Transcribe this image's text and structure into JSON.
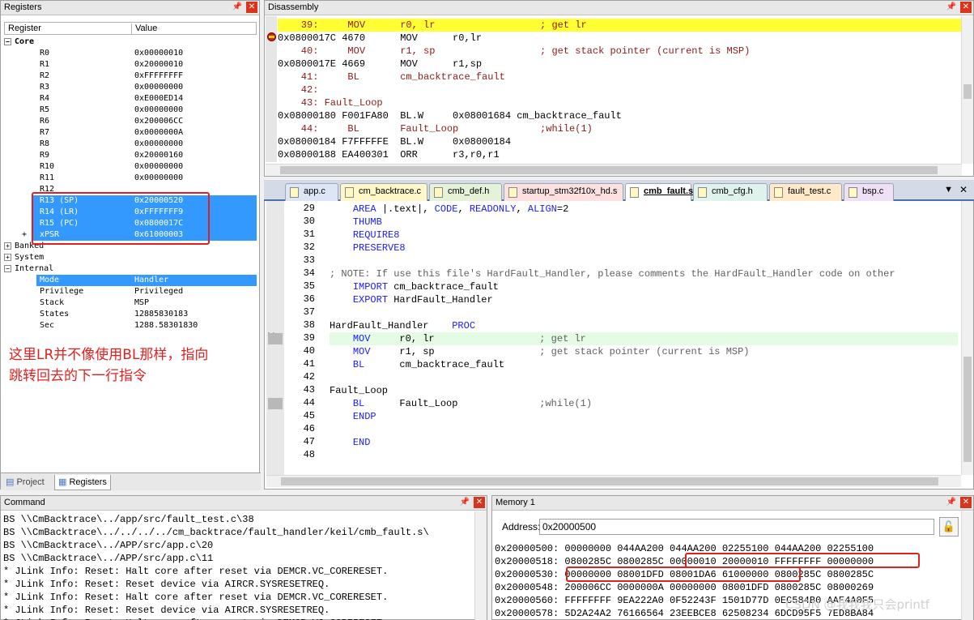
{
  "registers": {
    "title": "Registers",
    "col_register": "Register",
    "col_value": "Value",
    "core_label": "Core",
    "rows": [
      {
        "name": "R0",
        "value": "0x00000010"
      },
      {
        "name": "R1",
        "value": "0x20000010"
      },
      {
        "name": "R2",
        "value": "0xFFFFFFFF"
      },
      {
        "name": "R3",
        "value": "0x00000000"
      },
      {
        "name": "R4",
        "value": "0xE000ED14"
      },
      {
        "name": "R5",
        "value": "0x00000000"
      },
      {
        "name": "R6",
        "value": "0x200006CC"
      },
      {
        "name": "R7",
        "value": "0x0000000A"
      },
      {
        "name": "R8",
        "value": "0x00000000"
      },
      {
        "name": "R9",
        "value": "0x20000160"
      },
      {
        "name": "R10",
        "value": "0x00000000"
      },
      {
        "name": "R11",
        "value": "0x00000000"
      },
      {
        "name": "R12",
        "value": ""
      },
      {
        "name": "R13 (SP)",
        "value": "0x20000520"
      },
      {
        "name": "R14 (LR)",
        "value": "0xFFFFFFF9"
      },
      {
        "name": "R15 (PC)",
        "value": "0x0800017C"
      },
      {
        "name": "xPSR",
        "value": "0x61000003"
      }
    ],
    "banked_label": "Banked",
    "system_label": "System",
    "internal_label": "Internal",
    "internal_rows": [
      {
        "name": "Mode",
        "value": "Handler"
      },
      {
        "name": "Privilege",
        "value": "Privileged"
      },
      {
        "name": "Stack",
        "value": "MSP"
      },
      {
        "name": "States",
        "value": "12885830183"
      },
      {
        "name": "Sec",
        "value": "1288.58301830"
      }
    ],
    "annotation_line1": "这里LR并不像使用BL那样，指向",
    "annotation_line2": "跳转回去的下一行指令",
    "tab_project": "Project",
    "tab_registers": "Registers"
  },
  "disassembly": {
    "title": "Disassembly",
    "lines": [
      "    39:     MOV      r0, lr                  ; get lr",
      "0x0800017C 4670      MOV      r0,lr",
      "    40:     MOV      r1, sp                  ; get stack pointer (current is MSP)",
      "0x0800017E 4669      MOV      r1,sp",
      "    41:     BL       cm_backtrace_fault",
      "    42:",
      "    43: Fault_Loop",
      "0x08000180 F001FA80  BL.W     0x08001684 cm_backtrace_fault",
      "    44:     BL       Fault_Loop              ;while(1)",
      "0x08000184 F7FFFFFE  BL.W     0x08000184",
      "0x08000188 EA400301  ORR      r3,r0,r1"
    ]
  },
  "editor": {
    "tabs": [
      "app.c",
      "cm_backtrace.c",
      "cmb_def.h",
      "startup_stm32f10x_hd.s",
      "cmb_fault.s",
      "cmb_cfg.h",
      "fault_test.c",
      "bsp.c"
    ],
    "active_tab": "cmb_fault.s",
    "tab_colors": [
      "#dde6f5",
      "#fff7c8",
      "#e6f2d8",
      "#fde0e0",
      "#ffffff",
      "#e0f2ec",
      "#ffe9c8",
      "#f0e0f5"
    ],
    "lines": [
      {
        "n": "29",
        "t": "    AREA |.text|, CODE, READONLY, ALIGN=2"
      },
      {
        "n": "30",
        "t": "    THUMB"
      },
      {
        "n": "31",
        "t": "    REQUIRE8"
      },
      {
        "n": "32",
        "t": "    PRESERVE8"
      },
      {
        "n": "33",
        "t": ""
      },
      {
        "n": "34",
        "t": "; NOTE: If use this file's HardFault_Handler, please comments the HardFault_Handler code on other"
      },
      {
        "n": "35",
        "t": "    IMPORT cm_backtrace_fault"
      },
      {
        "n": "36",
        "t": "    EXPORT HardFault_Handler"
      },
      {
        "n": "37",
        "t": ""
      },
      {
        "n": "38",
        "t": "HardFault_Handler    PROC"
      },
      {
        "n": "39",
        "t": "    MOV     r0, lr                  ; get lr"
      },
      {
        "n": "40",
        "t": "    MOV     r1, sp                  ; get stack pointer (current is MSP)"
      },
      {
        "n": "41",
        "t": "    BL      cm_backtrace_fault"
      },
      {
        "n": "42",
        "t": ""
      },
      {
        "n": "43",
        "t": "Fault_Loop"
      },
      {
        "n": "44",
        "t": "    BL      Fault_Loop              ;while(1)"
      },
      {
        "n": "45",
        "t": "    ENDP"
      },
      {
        "n": "46",
        "t": ""
      },
      {
        "n": "47",
        "t": "    END"
      },
      {
        "n": "48",
        "t": ""
      }
    ]
  },
  "command": {
    "title": "Command",
    "lines": [
      "BS \\\\CmBacktrace\\../app/src/fault_test.c\\38",
      "BS \\\\CmBacktrace\\../../../../cm_backtrace/fault_handler/keil/cmb_fault.s\\",
      "BS \\\\CmBacktrace\\../APP/src/app.c\\20",
      "BS \\\\CmBacktrace\\../APP/src/app.c\\11",
      "* JLink Info: Reset: Halt core after reset via DEMCR.VC_CORERESET.",
      "* JLink Info: Reset: Reset device via AIRCR.SYSRESETREQ.",
      "* JLink Info: Reset: Halt core after reset via DEMCR.VC_CORERESET.",
      "* JLink Info: Reset: Reset device via AIRCR.SYSRESETREQ.",
      "* JLink Info: Reset: Halt core after reset via DEMCR.VC_CORERESET."
    ]
  },
  "memory": {
    "title": "Memory 1",
    "address_label": "Address:",
    "address_value": "0x20000500",
    "lines": [
      "0x20000500: 00000000 044AA200 044AA200 02255100 044AA200 02255100",
      "0x20000518: 0800285C 0800285C 00000010 20000010 FFFFFFFF 00000000",
      "0x20000530: 00000000 08001DFD 08001DA6 61000000 0800285C 0800285C",
      "0x20000548: 200006CC 0000000A 00000000 08001DFD 0800285C 08000269",
      "0x20000560: FFFFFFFF 9EA222A0 0F52243F 1501D77D 0EC584B0 AAE4A0F5",
      "0x20000578: 5D2A24A2 76166564 23EEBCE8 62508234 6DCD95F5 7ED8BA84"
    ]
  },
  "watermark": "CSDN @我我我只会printf"
}
